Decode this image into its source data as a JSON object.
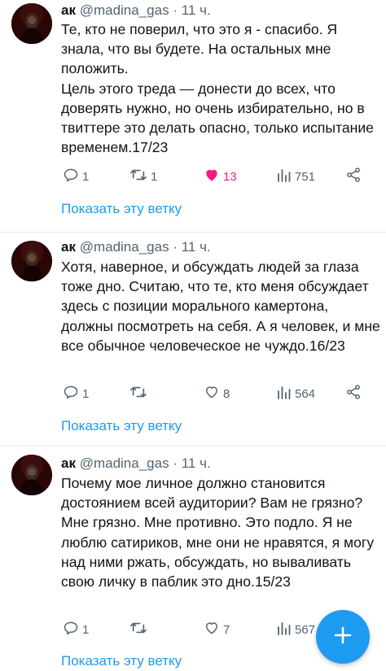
{
  "tweets": [
    {
      "author_name": "ак",
      "handle": "@madina_gas",
      "separator": "·",
      "time": "11 ч.",
      "text": "Те, кто не поверил, что это я - спасибо. Я знала, что вы будете. На остальных мне положить.\nЦель этого треда — донести до всех, что доверять нужно, но очень избирательно, но в твиттере это делать опасно, только испытание временем.17/23",
      "replies": "1",
      "retweets": "1",
      "likes": "13",
      "liked": true,
      "views": "751",
      "show_thread": "Показать эту ветку"
    },
    {
      "author_name": "ак",
      "handle": "@madina_gas",
      "separator": "·",
      "time": "11 ч.",
      "text": "Хотя, наверное, и обсуждать людей за глаза тоже дно. Считаю, что те, кто меня обсуждает здесь с позиции морального камертона, должны посмотреть на себя. А я человек, и мне все обычное человеческое не чуждо.16/23",
      "replies": "1",
      "retweets": "",
      "likes": "8",
      "liked": false,
      "views": "564",
      "show_thread": "Показать эту ветку"
    },
    {
      "author_name": "ак",
      "handle": "@madina_gas",
      "separator": "·",
      "time": "11 ч.",
      "text": "Почему мое личное должно становится достоянием всей аудитории? Вам не грязно? Мне грязно. Мне противно. Это подло. Я не люблю сатириков, мне они не нравятся, я могу над ними ржать, обсуждать, но вываливать свою личку в паблик это дно.15/23",
      "replies": "1",
      "retweets": "",
      "likes": "7",
      "liked": false,
      "views": "567",
      "show_thread": "Показать эту ветку"
    }
  ],
  "icons": {
    "reply": "reply-icon",
    "retweet": "retweet-icon",
    "like": "heart-icon",
    "views": "views-icon",
    "share": "share-icon",
    "compose": "plus-icon"
  },
  "colors": {
    "accent": "#1d9bf0",
    "like_active": "#f91880",
    "muted": "#536471",
    "text": "#0f1419",
    "divider": "#e6e9ec"
  }
}
